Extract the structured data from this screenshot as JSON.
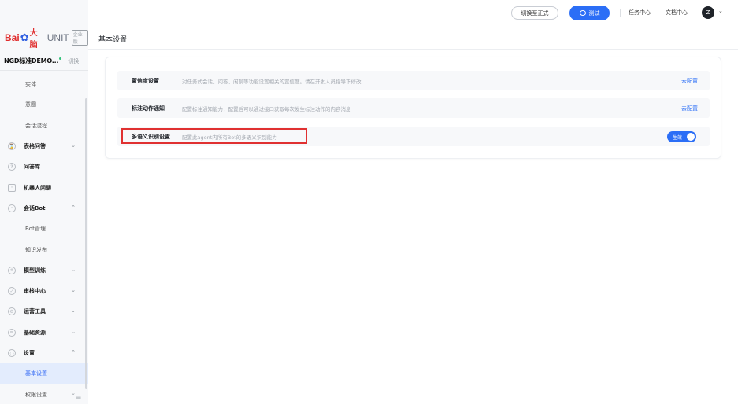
{
  "logo": {
    "bai": "Bai",
    "dana": "大脑",
    "unit": "UNIT",
    "edition": "企业版"
  },
  "agent": {
    "name": "NGD标准DEMO...",
    "switch_label": "切换"
  },
  "sidebar": {
    "items": [
      {
        "label": "实体"
      },
      {
        "label": "意图"
      },
      {
        "label": "会话流程"
      },
      {
        "label": "表格问答",
        "icon": "table-icon"
      },
      {
        "label": "问答库",
        "icon": "question-icon"
      },
      {
        "label": "机器人闲聊",
        "icon": "chat-icon"
      },
      {
        "label": "会话Bot",
        "icon": "bot-icon"
      },
      {
        "label": "Bot管理"
      },
      {
        "label": "知识发布"
      },
      {
        "label": "模型训练",
        "icon": "model-icon"
      },
      {
        "label": "审核中心",
        "icon": "shield-icon"
      },
      {
        "label": "运营工具",
        "icon": "tool-icon"
      },
      {
        "label": "基础资源",
        "icon": "resource-icon"
      },
      {
        "label": "设置",
        "icon": "settings-icon"
      },
      {
        "label": "基本设置"
      },
      {
        "label": "权限设置"
      }
    ],
    "fold_icon": "collapse-icon"
  },
  "topbar": {
    "switch_formal": "切换至正式",
    "test_button": "测试",
    "task_center": "任务中心",
    "doc_center": "文档中心",
    "avatar_letter": "Z"
  },
  "page": {
    "title": "基本设置"
  },
  "settings": [
    {
      "name": "置信度设置",
      "desc": "对任务式会话、问答、闲聊等功能设置相关的置信度。请在开发人员指导下修改",
      "action": "去配置"
    },
    {
      "name": "标注动作通知",
      "desc": "配置标注通知能力，配置后可以通过接口获取每次发生标注动作的内容消息",
      "action": "去配置"
    },
    {
      "name": "多语义识别设置",
      "desc": "配置此agent内所有Bot的多语义识别能力",
      "toggle_label": "生效",
      "toggle_on": true
    }
  ],
  "colors": {
    "accent": "#2b6ef6",
    "highlight": "#e03131",
    "active_bg": "#e3ecfd"
  }
}
